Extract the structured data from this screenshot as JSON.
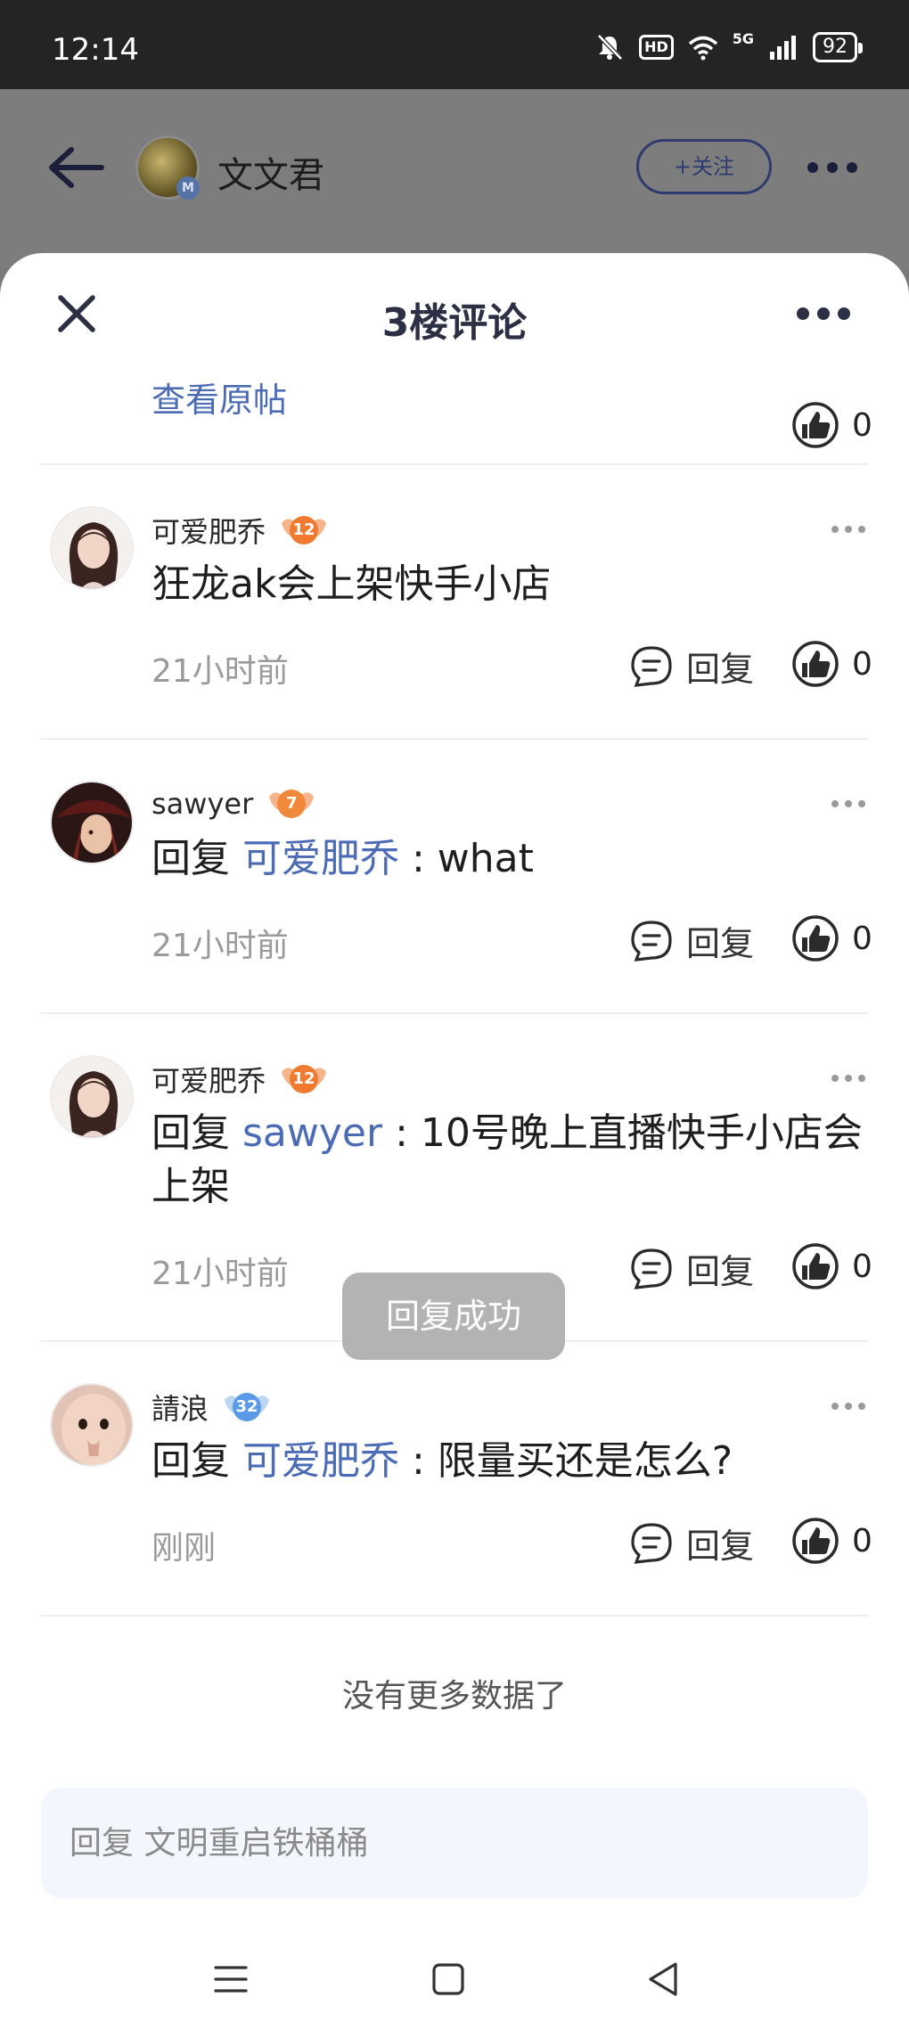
{
  "status_bar": {
    "time": "12:14",
    "battery": "92",
    "network": "5G"
  },
  "page_header": {
    "author_name": "文文君",
    "follow_label": "+关注",
    "author_badge": "M"
  },
  "sheet": {
    "title": "3楼评论",
    "view_original": "查看原帖",
    "original_likes": "0"
  },
  "comments": [
    {
      "name": "可爱肥乔",
      "level": "12",
      "text": "狂龙ak会上架快手小店",
      "reply_prefix": "",
      "mention": "",
      "after": "",
      "time": "21小时前",
      "reply_label": "回复",
      "likes": "0"
    },
    {
      "name": "sawyer",
      "level": "7",
      "text": "",
      "reply_prefix": "回复 ",
      "mention": "可爱肥乔",
      "after": " : what",
      "time": "21小时前",
      "reply_label": "回复",
      "likes": "0"
    },
    {
      "name": "可爱肥乔",
      "level": "12",
      "text": "",
      "reply_prefix": "回复 ",
      "mention": "sawyer",
      "after": " : 10号晚上直播快手小店会上架",
      "time": "21小时前",
      "reply_label": "回复",
      "likes": "0"
    },
    {
      "name": "請浪",
      "level": "32",
      "text": "",
      "reply_prefix": "回复 ",
      "mention": "可爱肥乔",
      "after": " : 限量买还是怎么?",
      "time": "刚刚",
      "reply_label": "回复",
      "likes": "0"
    }
  ],
  "toast": "回复成功",
  "no_more": "没有更多数据了",
  "reply_input": {
    "placeholder": "回复 文明重启铁桶桶",
    "value": ""
  },
  "colors": {
    "accent": "#4b6bb5",
    "title": "#2d2f45",
    "toast_bg": "#b3b3b3"
  }
}
